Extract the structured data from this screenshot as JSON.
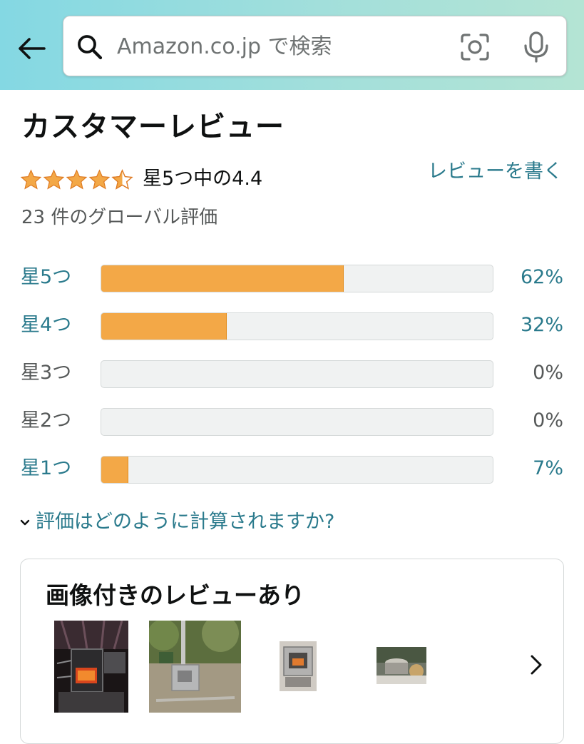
{
  "search": {
    "placeholder": "Amazon.co.jp で検索"
  },
  "reviews": {
    "heading": "カスタマーレビュー",
    "rating_text": "星5つ中の4.4",
    "rating_value": 4.4,
    "write_review_label": "レビューを書く",
    "global_ratings": "23 件のグローバル評価"
  },
  "histogram": [
    {
      "label": "星5つ",
      "percent_label": "62%",
      "percent": 62,
      "active": true
    },
    {
      "label": "星4つ",
      "percent_label": "32%",
      "percent": 32,
      "active": true
    },
    {
      "label": "星3つ",
      "percent_label": "0%",
      "percent": 0,
      "active": false
    },
    {
      "label": "星2つ",
      "percent_label": "0%",
      "percent": 0,
      "active": false
    },
    {
      "label": "星1つ",
      "percent_label": "7%",
      "percent": 7,
      "active": true
    }
  ],
  "how_calculated_label": "評価はどのように計算されますか?",
  "image_reviews": {
    "title": "画像付きのレビューあり"
  },
  "colors": {
    "link": "#2a7a8c",
    "star": "#f3a847",
    "bar_fill": "#f3a847",
    "bar_bg": "#f0f2f2"
  }
}
